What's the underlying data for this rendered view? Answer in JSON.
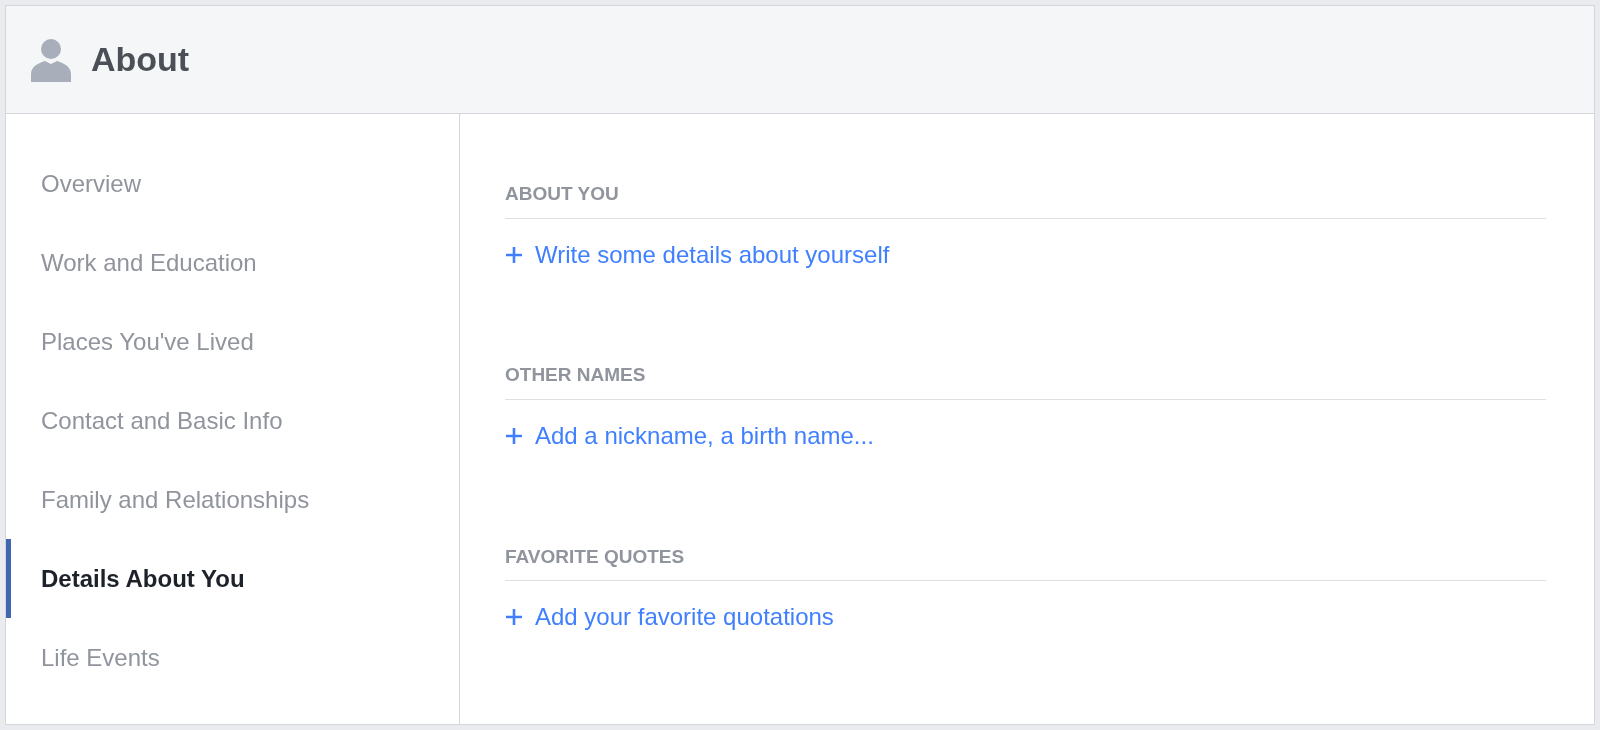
{
  "header": {
    "title": "About"
  },
  "sidebar": {
    "items": [
      {
        "label": "Overview",
        "selected": false
      },
      {
        "label": "Work and Education",
        "selected": false
      },
      {
        "label": "Places You've Lived",
        "selected": false
      },
      {
        "label": "Contact and Basic Info",
        "selected": false
      },
      {
        "label": "Family and Relationships",
        "selected": false
      },
      {
        "label": "Details About You",
        "selected": true
      },
      {
        "label": "Life Events",
        "selected": false
      }
    ]
  },
  "sections": [
    {
      "heading": "ABOUT YOU",
      "link": "Write some details about yourself"
    },
    {
      "heading": "OTHER NAMES",
      "link": "Add a nickname, a birth name..."
    },
    {
      "heading": "FAVORITE QUOTES",
      "link": "Add your favorite quotations"
    }
  ]
}
